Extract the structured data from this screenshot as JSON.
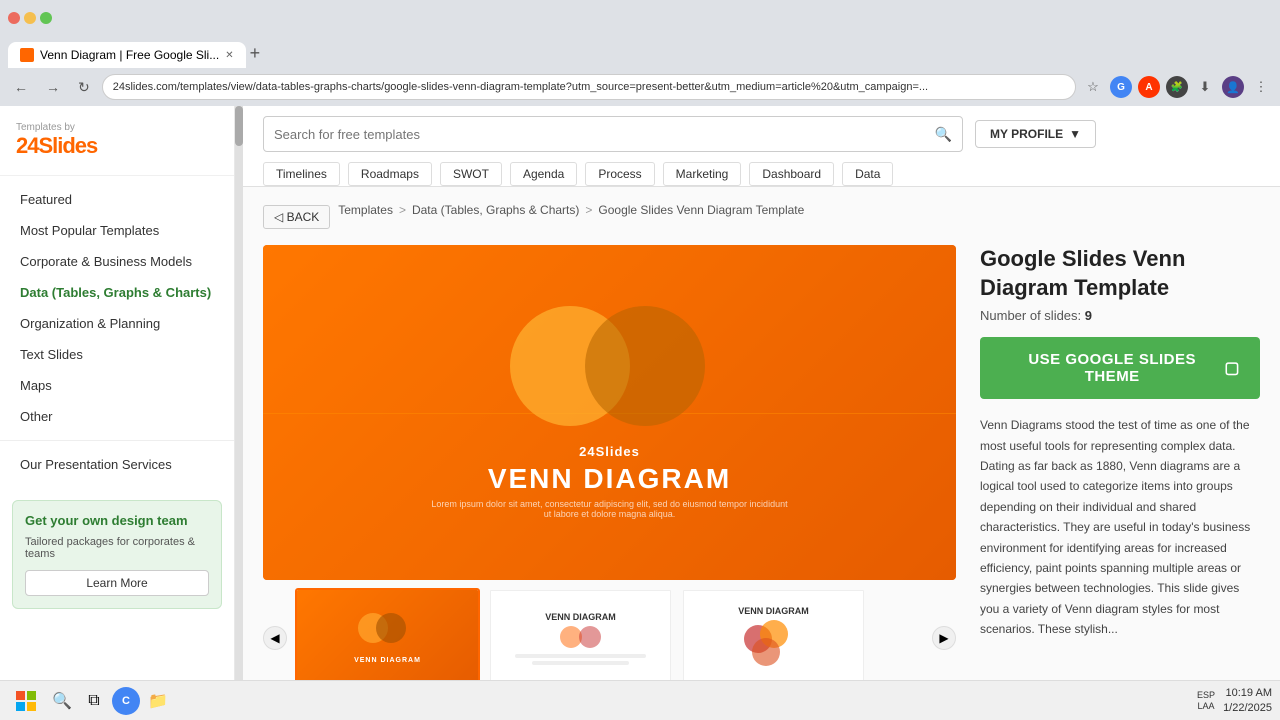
{
  "browser": {
    "tab_title": "Venn Diagram | Free Google Sli...",
    "url": "24slides.com/templates/view/data-tables-graphs-charts/google-slides-venn-diagram-template?utm_source=present-better&utm_medium=article%20&utm_campaign=...",
    "tab_new_label": "+",
    "nav_back": "←",
    "nav_forward": "→",
    "nav_refresh": "↻"
  },
  "logo": {
    "by_text": "Templates by",
    "name": "24Slides"
  },
  "search": {
    "placeholder": "Search for free templates"
  },
  "my_profile": {
    "label": "MY PROFILE"
  },
  "category_tags": [
    "Timelines",
    "Roadmaps",
    "SWOT",
    "Agenda",
    "Process",
    "Marketing",
    "Dashboard",
    "Data"
  ],
  "breadcrumb": {
    "back": "◁ BACK",
    "items": [
      "Templates",
      "Data (Tables, Graphs & Charts)",
      "Google Slides Venn Diagram Template"
    ],
    "separators": [
      ">",
      ">"
    ]
  },
  "sidebar": {
    "items": [
      {
        "label": "Featured",
        "active": false
      },
      {
        "label": "Most Popular Templates",
        "active": false
      },
      {
        "label": "Corporate & Business Models",
        "active": false
      },
      {
        "label": "Data (Tables, Graphs & Charts)",
        "active": true
      },
      {
        "label": "Organization & Planning",
        "active": false
      },
      {
        "label": "Text Slides",
        "active": false
      },
      {
        "label": "Maps",
        "active": false
      },
      {
        "label": "Other",
        "active": false
      },
      {
        "label": "Our Presentation Services",
        "active": false
      }
    ],
    "promo": {
      "title": "Get your own design team",
      "description": "Tailored packages for corporates & teams",
      "button_label": "Learn More"
    }
  },
  "template": {
    "slide_logo": "24Slides",
    "slide_title": "VENN DIAGRAM",
    "slide_subtitle": "Lorem ipsum dolor sit amet, consectetur adipiscing elit, sed do eiusmod tempor incididunt ut labore et dolore magna aliqua.",
    "title": "Google Slides Venn Diagram Template",
    "slide_count_label": "Number of slides:",
    "slide_count": "9",
    "use_button_label": "USE GOOGLE SLIDES THEME",
    "description": "Venn Diagrams stood the test of time as one of the most useful tools for representing complex data. Dating as far back as 1880, Venn diagrams are a logical tool used to categorize items into groups depending on their individual and shared characteristics. They are useful in today's business environment for identifying areas for increased efficiency, paint points spanning multiple areas or synergies between technologies. This slide gives you a variety of Venn diagram styles for most scenarios. These stylish..."
  },
  "taskbar": {
    "time": "10:19 AM",
    "date": "1/22/2025",
    "lang": "ESP\nLAA"
  }
}
